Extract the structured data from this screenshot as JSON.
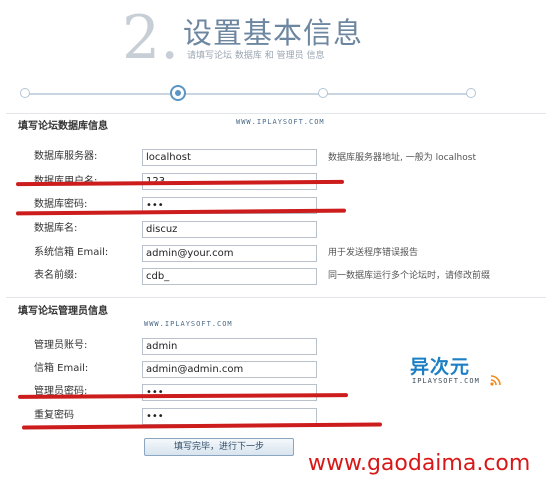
{
  "header": {
    "step_number": "2.",
    "title": "设置基本信息",
    "subtitle": "请填写论坛 数据库 和 管理员 信息"
  },
  "progress": {
    "steps": 4,
    "current": 2
  },
  "db_section": {
    "title": "填写论坛数据库信息",
    "watermark": "WWW.IPLAYSOFT.COM",
    "fields": [
      {
        "label": "数据库服务器:",
        "value": "localhost",
        "tip": "数据库服务器地址, 一般为 localhost"
      },
      {
        "label": "数据库用户名:",
        "value": "123",
        "tip": ""
      },
      {
        "label": "数据库密码:",
        "value": "•••",
        "tip": ""
      },
      {
        "label": "数据库名:",
        "value": "discuz",
        "tip": ""
      },
      {
        "label": "系统信箱 Email:",
        "value": "admin@your.com",
        "tip": "用于发送程序错误报告"
      },
      {
        "label": "表名前缀:",
        "value": "cdb_",
        "tip": "同一数据库运行多个论坛时，请修改前缀"
      }
    ]
  },
  "admin_section": {
    "title": "填写论坛管理员信息",
    "watermark": "WWW.IPLAYSOFT.COM",
    "fields": [
      {
        "label": "管理员账号:",
        "value": "admin"
      },
      {
        "label": "信箱 Email:",
        "value": "admin@admin.com"
      },
      {
        "label": "管理员密码:",
        "value": "•••"
      },
      {
        "label": "重复密码",
        "value": "•••"
      }
    ]
  },
  "submit_label": "填写完毕，进行下一步",
  "logo": {
    "cn": "异次元",
    "en": "IPLAYSOFT.COM"
  },
  "site_watermark": "www.gaodaima.com",
  "annotation_color": "#cc1c1c"
}
